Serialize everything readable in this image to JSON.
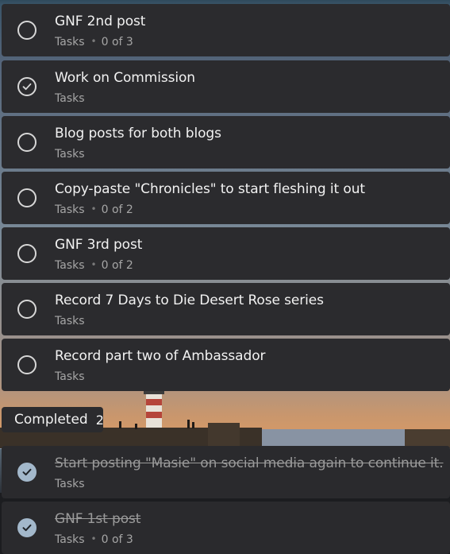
{
  "tasks": [
    {
      "title": "GNF 2nd post",
      "list": "Tasks",
      "steps": "0 of 3",
      "status": "open"
    },
    {
      "title": "Work on Commission",
      "list": "Tasks",
      "steps": "",
      "status": "hover-check"
    },
    {
      "title": "Blog posts for both blogs",
      "list": "Tasks",
      "steps": "",
      "status": "open"
    },
    {
      "title": "Copy-paste \"Chronicles\" to start fleshing it out",
      "list": "Tasks",
      "steps": "0 of 2",
      "status": "open"
    },
    {
      "title": "GNF 3rd post",
      "list": "Tasks",
      "steps": "0 of 2",
      "status": "open"
    },
    {
      "title": "Record 7 Days to Die Desert Rose series",
      "list": "Tasks",
      "steps": "",
      "status": "open"
    },
    {
      "title": "Record part two of Ambassador",
      "list": "Tasks",
      "steps": "",
      "status": "open"
    }
  ],
  "completed_section": {
    "label": "Completed",
    "count": "2",
    "icon": "chevron-down-icon"
  },
  "completed_tasks": [
    {
      "title": "Start posting \"Masie\" on social media again to continue it.",
      "list": "Tasks",
      "steps": ""
    },
    {
      "title": "GNF 1st post",
      "list": "Tasks",
      "steps": "0 of 3"
    }
  ],
  "colors": {
    "card": "#2b2b2e",
    "text": "#f2f2f2",
    "subtext": "#a6a6a6",
    "completed_check": "#a3b8cb"
  }
}
